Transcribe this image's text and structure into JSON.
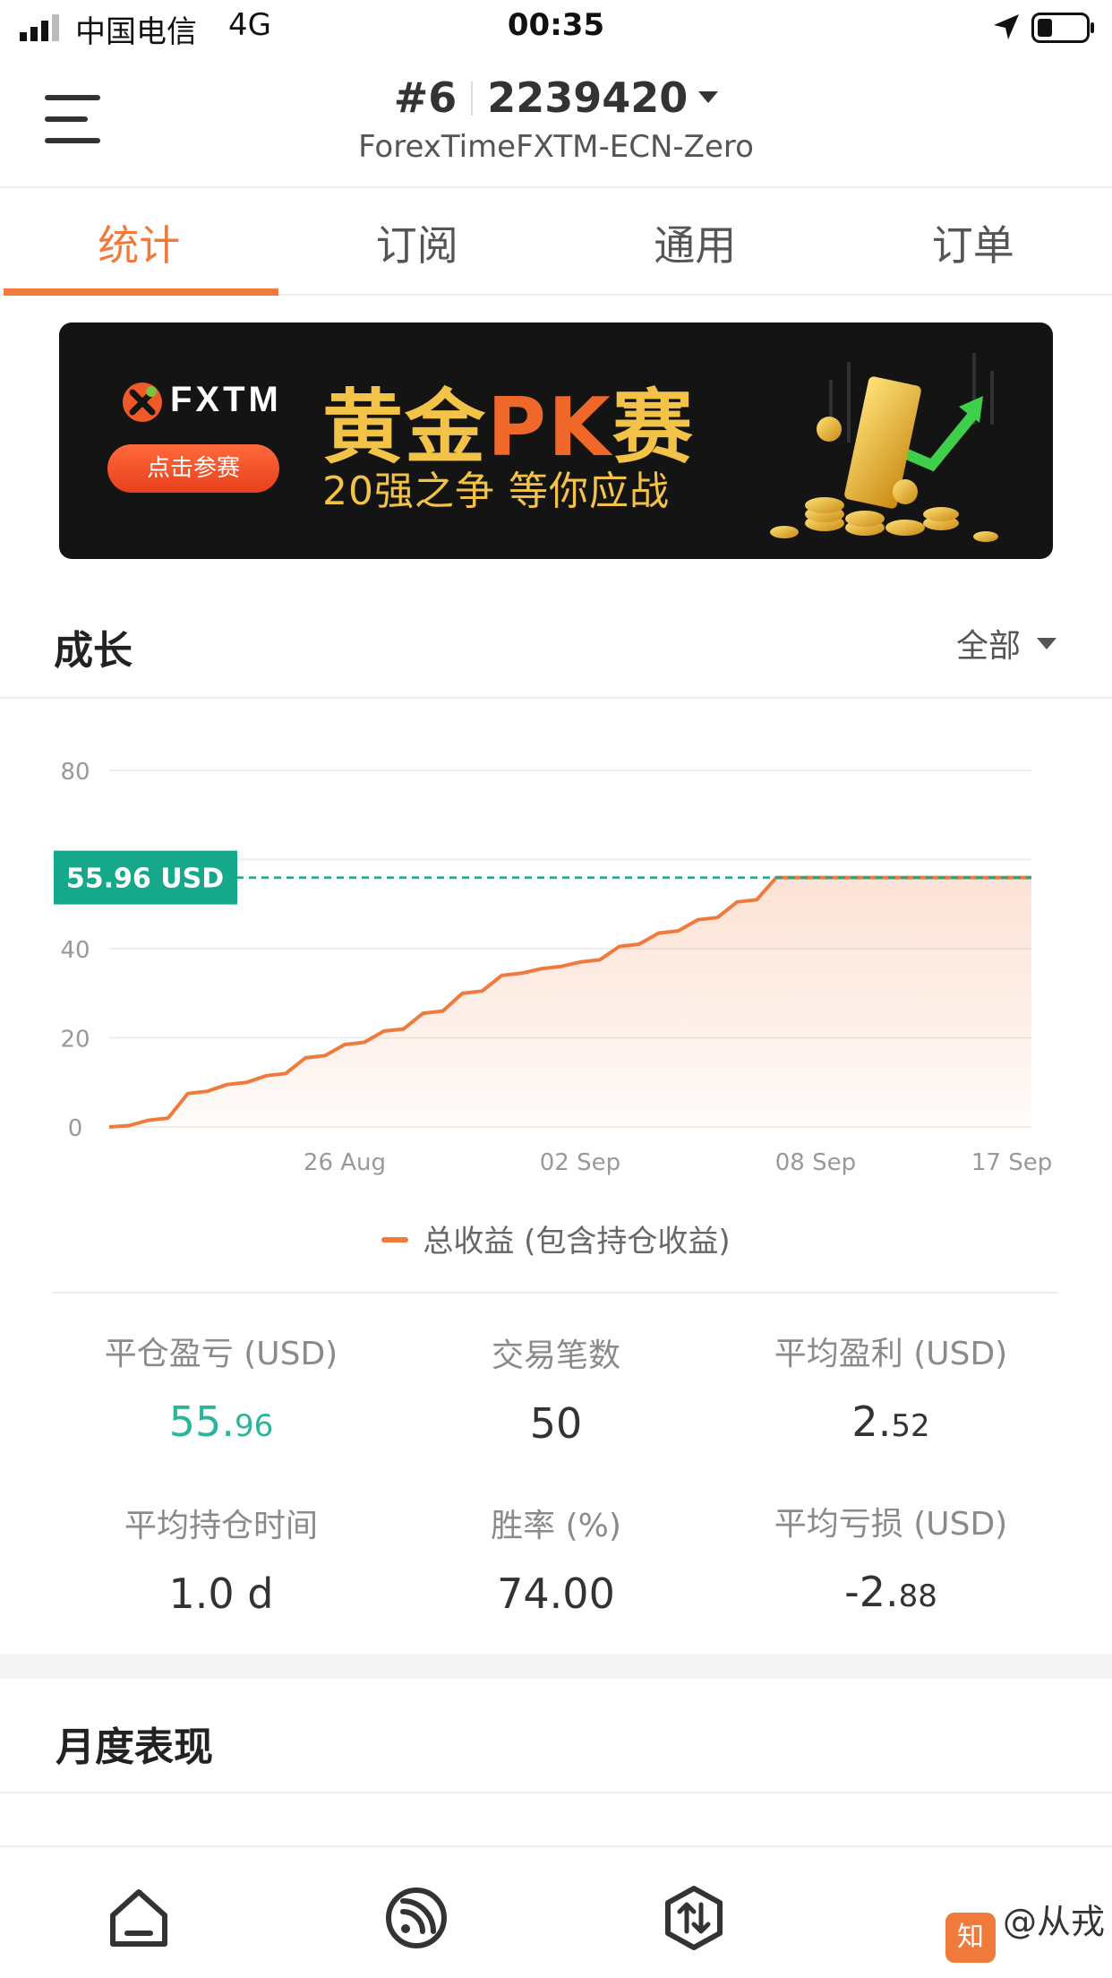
{
  "status_bar": {
    "carrier": "中国电信",
    "network": "4G",
    "time": "00:35"
  },
  "header": {
    "account_rank": "#6",
    "account_number": "2239420",
    "server": "ForexTimeFXTM-ECN-Zero"
  },
  "tabs": [
    {
      "label": "统计",
      "active": true
    },
    {
      "label": "订阅",
      "active": false
    },
    {
      "label": "通用",
      "active": false
    },
    {
      "label": "订单",
      "active": false
    }
  ],
  "banner": {
    "brand": "FXTM",
    "button_label": "点击参赛",
    "headline_a": "黄金",
    "headline_pk": "PK",
    "headline_b": "赛",
    "subline": "20强之争  等你应战"
  },
  "growth": {
    "title": "成长",
    "filter": "全部"
  },
  "chart_data": {
    "type": "area",
    "title": "",
    "xlabel": "",
    "ylabel": "",
    "ylim": [
      0,
      80
    ],
    "yticks": [
      0,
      20,
      40,
      80
    ],
    "xticks": [
      "26 Aug",
      "02 Sep",
      "08 Sep",
      "17 Sep"
    ],
    "xticks_at": [
      6,
      12,
      18,
      23
    ],
    "current_value_label": "55.96 USD",
    "current_value": 55.96,
    "series": [
      {
        "name": "总收益 (包含持仓收益)",
        "color": "#f07a3c",
        "x": [
          0,
          0.5,
          1,
          1.5,
          2,
          2.5,
          3,
          3.5,
          4,
          4.5,
          5,
          5.5,
          6,
          6.5,
          7,
          7.5,
          8,
          8.5,
          9,
          9.5,
          10,
          10.5,
          11,
          11.5,
          12,
          12.5,
          13,
          13.5,
          14,
          14.5,
          15,
          15.5,
          16,
          16.5,
          17,
          17.5,
          18,
          18.5,
          19,
          19.5,
          20,
          20.5,
          21,
          21.5,
          22,
          22.5,
          23,
          23.5
        ],
        "y": [
          0,
          0.3,
          1.5,
          2,
          7.5,
          8,
          9.5,
          10,
          11.5,
          12,
          15.5,
          16,
          18.5,
          19,
          21.5,
          22,
          25.5,
          26,
          30,
          30.5,
          34,
          34.5,
          35.5,
          36,
          37,
          37.5,
          40.5,
          41,
          43.5,
          44,
          46.5,
          47,
          50.5,
          51,
          55.96,
          55.96,
          55.96,
          55.96,
          55.96,
          55.96,
          55.96,
          55.96,
          55.96,
          55.96,
          55.96,
          55.96,
          55.96,
          55.96
        ]
      }
    ],
    "grid": true,
    "legend": "bottom-center"
  },
  "stats": [
    {
      "label": "平仓盈亏 (USD)",
      "major": "55.",
      "minor": "96",
      "color": "#2bb59a"
    },
    {
      "label": "交易笔数",
      "major": "50",
      "minor": ""
    },
    {
      "label": "平均盈利 (USD)",
      "major": "2.",
      "minor": "52"
    },
    {
      "label": "平均持仓时间",
      "major": "1.0 d",
      "minor": ""
    },
    {
      "label": "胜率 (%)",
      "major": "74.00",
      "minor": ""
    },
    {
      "label": "平均亏损 (USD)",
      "major": "-2.",
      "minor": "88"
    }
  ],
  "monthly": {
    "title": "月度表现"
  },
  "bottom_nav": {
    "icons": [
      "home-icon",
      "feed-icon",
      "trade-icon",
      "profile-icon"
    ],
    "watermark": "@从戎"
  }
}
